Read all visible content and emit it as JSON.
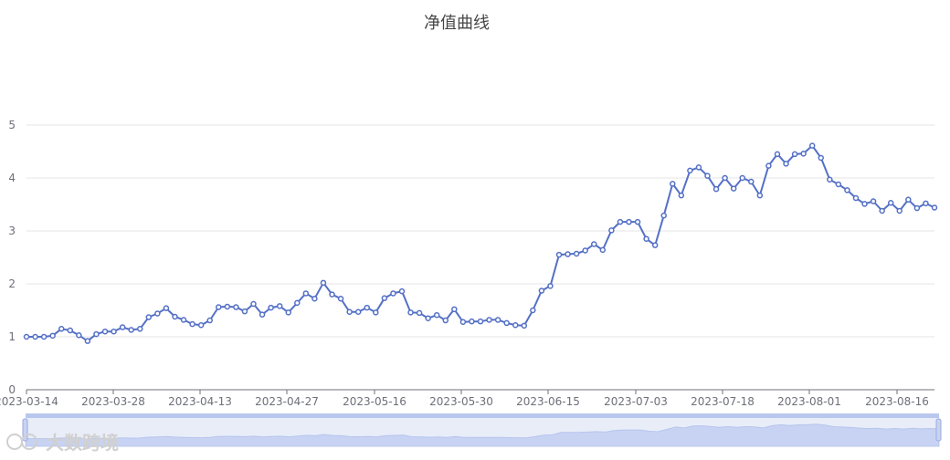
{
  "chart_data": {
    "type": "line",
    "title": "净值曲线",
    "xlabel": "",
    "ylabel": "",
    "ylim": [
      0,
      5
    ],
    "y_ticks": [
      0,
      1,
      2,
      3,
      4,
      5
    ],
    "grid": true,
    "x_tick_labels": [
      "2023-03-14",
      "2023-03-28",
      "2023-04-13",
      "2023-04-27",
      "2023-05-16",
      "2023-05-30",
      "2023-06-15",
      "2023-07-03",
      "2023-07-18",
      "2023-08-01",
      "2023-08-16"
    ],
    "series": [
      {
        "color": "#5470c6",
        "values": [
          1.0,
          1.0,
          1.0,
          1.02,
          1.15,
          1.12,
          1.03,
          0.92,
          1.05,
          1.1,
          1.1,
          1.18,
          1.13,
          1.15,
          1.37,
          1.44,
          1.54,
          1.38,
          1.32,
          1.24,
          1.22,
          1.31,
          1.56,
          1.57,
          1.56,
          1.48,
          1.62,
          1.42,
          1.55,
          1.58,
          1.46,
          1.64,
          1.82,
          1.72,
          2.02,
          1.8,
          1.72,
          1.47,
          1.47,
          1.55,
          1.46,
          1.73,
          1.82,
          1.86,
          1.46,
          1.45,
          1.35,
          1.41,
          1.31,
          1.52,
          1.28,
          1.29,
          1.29,
          1.32,
          1.32,
          1.26,
          1.22,
          1.21,
          1.5,
          1.87,
          1.96,
          2.55,
          2.56,
          2.57,
          2.63,
          2.75,
          2.64,
          3.01,
          3.17,
          3.17,
          3.17,
          2.85,
          2.73,
          3.29,
          3.89,
          3.67,
          4.14,
          4.2,
          4.04,
          3.79,
          4.0,
          3.8,
          4.0,
          3.93,
          3.67,
          4.23,
          4.45,
          4.27,
          4.45,
          4.46,
          4.61,
          4.38,
          3.97,
          3.88,
          3.77,
          3.62,
          3.51,
          3.56,
          3.38,
          3.53,
          3.38,
          3.59,
          3.43,
          3.52,
          3.44
        ]
      }
    ]
  },
  "datazoom": {
    "range_percent": [
      0,
      100
    ]
  },
  "watermark": {
    "text": "大数跨境"
  }
}
